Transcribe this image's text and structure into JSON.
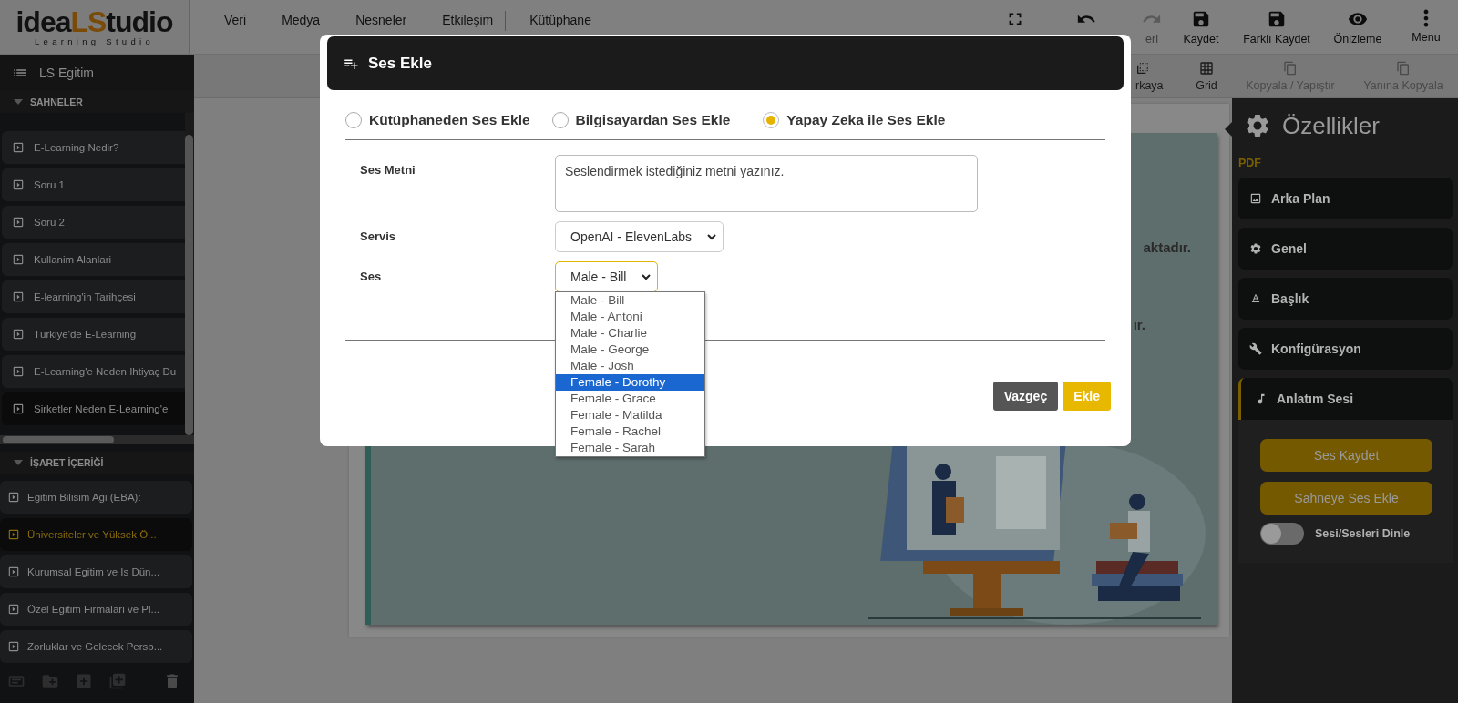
{
  "toolbar": {
    "logo": {
      "parts": [
        {
          "text": "idea",
          "accent": false
        },
        {
          "text": "LS",
          "accent": true
        },
        {
          "text": "tudio",
          "accent": false
        }
      ],
      "subtitle": "Learning Studio"
    },
    "menu": [
      "Veri",
      "Medya",
      "Nesneler",
      "Etkileşim",
      "Kütüphane"
    ],
    "actions": [
      {
        "disabled": false
      },
      {
        "disabled": false
      },
      {
        "label": "eri",
        "disabled": true
      },
      {
        "label": "Kaydet",
        "disabled": false
      },
      {
        "label": "Farklı Kaydet",
        "disabled": false
      },
      {
        "label": "Önizleme",
        "disabled": false
      },
      {
        "label": "Menu",
        "disabled": false
      }
    ]
  },
  "subtoolbar": [
    {
      "label": "rkaya",
      "disabled": false
    },
    {
      "label": "Grid",
      "disabled": false
    },
    {
      "label": "Kopyala / Yapıştır",
      "disabled": true
    },
    {
      "label": "Yanına Kopyala",
      "disabled": true
    }
  ],
  "sidebar": {
    "title": "LS Egitim",
    "sections": [
      {
        "kind": "scenes",
        "title": "SAHNELER",
        "expanded": true,
        "items": [
          {
            "label": "E-Learning Nedir?",
            "selected": false
          },
          {
            "label": "Soru 1",
            "selected": false
          },
          {
            "label": "Soru 2",
            "selected": false
          },
          {
            "label": "Kullanim Alanlari",
            "selected": false
          },
          {
            "label": "E-learning'in Tarihçesi",
            "selected": false
          },
          {
            "label": "Türkiye'de E-Learning",
            "selected": false
          },
          {
            "label": "E-Learning'e Neden Ihtiyaç Du",
            "selected": false
          },
          {
            "label": "Sirketler Neden E-Learning'e",
            "selected": true
          }
        ]
      },
      {
        "kind": "markers",
        "title": "İŞARET İÇERİĞİ",
        "expanded": true,
        "items": [
          {
            "label": "Egitim Bilisim Agi (EBA):",
            "selected": false
          },
          {
            "label": "Üniversiteler ve Yüksek Ö...",
            "selected": true
          },
          {
            "label": "Kurumsal Egitim ve Is Dün...",
            "selected": false
          },
          {
            "label": "Özel Egitim Firmalari ve Pl...",
            "selected": false
          },
          {
            "label": "Zorluklar ve Gelecek Persp...",
            "selected": false
          }
        ]
      }
    ]
  },
  "stage": {
    "slide_texts": [
      "aktadır.",
      "ır."
    ]
  },
  "properties": {
    "title": "Özellikler",
    "context": "PDF",
    "panels": [
      {
        "label": "Arka Plan",
        "expanded": false
      },
      {
        "label": "Genel",
        "expanded": false
      },
      {
        "label": "Başlık",
        "expanded": false
      },
      {
        "label": "Konfigürasyon",
        "expanded": false
      },
      {
        "label": "Anlatım Sesi",
        "expanded": true
      }
    ],
    "buttons": [
      "Ses Kaydet",
      "Sahneye Ses Ekle"
    ],
    "toggle": {
      "label": "Sesi/Sesleri Dinle",
      "on": false
    }
  },
  "modal": {
    "title": "Ses Ekle",
    "sources": [
      {
        "label": "Kütüphaneden Ses Ekle",
        "selected": false
      },
      {
        "label": "Bilgisayardan Ses Ekle",
        "selected": false
      },
      {
        "label": "Yapay Zeka ile Ses Ekle",
        "selected": true
      }
    ],
    "fields": [
      {
        "kind": "textarea",
        "label": "Ses Metni",
        "placeholder": "Seslendirmek istediğiniz metni yazınız."
      },
      {
        "kind": "select",
        "label": "Servis",
        "value": "OpenAI - ElevenLabs",
        "expanded": false
      },
      {
        "kind": "select",
        "label": "Ses",
        "value": "Male - Bill",
        "expanded": true,
        "options": [
          {
            "label": "Male - Bill",
            "highlighted": false
          },
          {
            "label": "Male - Antoni",
            "highlighted": false
          },
          {
            "label": "Male - Charlie",
            "highlighted": false
          },
          {
            "label": "Male - George",
            "highlighted": false
          },
          {
            "label": "Male - Josh",
            "highlighted": false
          },
          {
            "label": "Female - Dorothy",
            "highlighted": true
          },
          {
            "label": "Female - Grace",
            "highlighted": false
          },
          {
            "label": "Female - Matilda",
            "highlighted": false
          },
          {
            "label": "Female - Rachel",
            "highlighted": false
          },
          {
            "label": "Female - Sarah",
            "highlighted": false
          }
        ]
      }
    ],
    "buttons": [
      {
        "label": "Vazgeç",
        "kind": "secondary"
      },
      {
        "label": "Ekle",
        "kind": "primary"
      }
    ]
  }
}
